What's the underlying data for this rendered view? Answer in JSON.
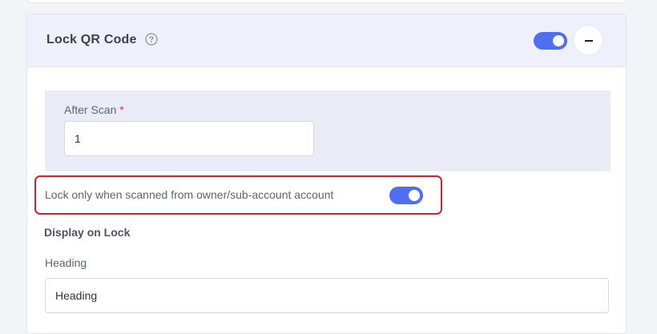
{
  "panel": {
    "title": "Lock QR Code",
    "help_icon": "question-circle-icon",
    "enabled": true,
    "collapse_icon": "minus-icon"
  },
  "after_scan": {
    "label": "After Scan",
    "required_marker": "*",
    "value": "1"
  },
  "lock_owner": {
    "label": "Lock only when scanned from owner/sub-account account",
    "enabled": true
  },
  "display_on_lock": {
    "section_title": "Display on Lock",
    "heading_label": "Heading",
    "heading_value": "Heading"
  },
  "colors": {
    "accent": "#4f6ef2",
    "highlight_border": "#d0212d",
    "header_bg": "#eef0fb"
  }
}
